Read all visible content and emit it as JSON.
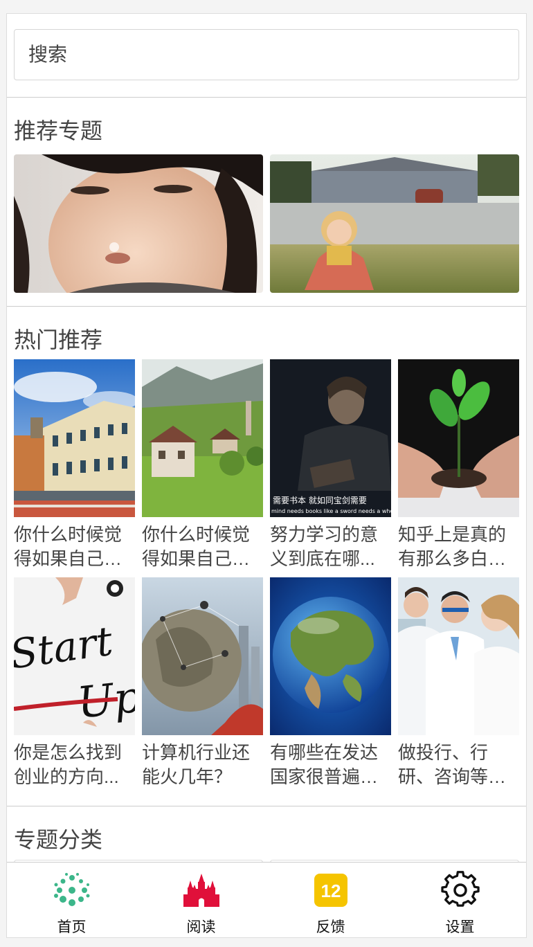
{
  "search": {
    "placeholder": "搜索"
  },
  "sections": {
    "recommended_title": "推荐专题",
    "hot_title": "热门推荐",
    "category_title": "专题分类"
  },
  "recommended": [
    {
      "image": "girl-blowing-bubble-photo"
    },
    {
      "image": "child-sitting-on-lawn-photo"
    }
  ],
  "hot": [
    {
      "line1": "你什么时候觉",
      "line2": "得如果自己不...",
      "image": "venice-buildings-photo"
    },
    {
      "line1": "你什么时候觉",
      "line2": "得如果自己不...",
      "image": "mountain-village-photo"
    },
    {
      "line1": "努力学习的意",
      "line2": "义到底在哪...",
      "image": "man-with-book-photo",
      "caption_cn": "需要书本  就如同宝剑需要",
      "caption_en": "mind needs books like a sword needs a whe"
    },
    {
      "line1": "知乎上是真的",
      "line2": "有那么多白手...",
      "image": "seedling-in-hands-photo"
    },
    {
      "line1": "你是怎么找到",
      "line2": "创业的方向...",
      "image": "start-up-whiteboard-photo",
      "art_text": "Start Up"
    },
    {
      "line1": "计算机行业还",
      "line2": "能火几年？",
      "image": "network-globe-photo"
    },
    {
      "line1": "有哪些在发达",
      "line2": "国家很普遍，...",
      "image": "earth-globe-photo"
    },
    {
      "line1": "做投行、行",
      "line2": "研、咨询等金...",
      "image": "lab-scientists-photo"
    }
  ],
  "tabbar": [
    {
      "label": "首页",
      "icon": "home-dots-icon",
      "color": "#3cb68a"
    },
    {
      "label": "阅读",
      "icon": "castle-icon",
      "color": "#e0103a"
    },
    {
      "label": "反馈",
      "icon": "calendar-badge-icon",
      "color": "#f5c400",
      "badge": "12"
    },
    {
      "label": "设置",
      "icon": "gear-icon",
      "color": "#111111"
    }
  ]
}
